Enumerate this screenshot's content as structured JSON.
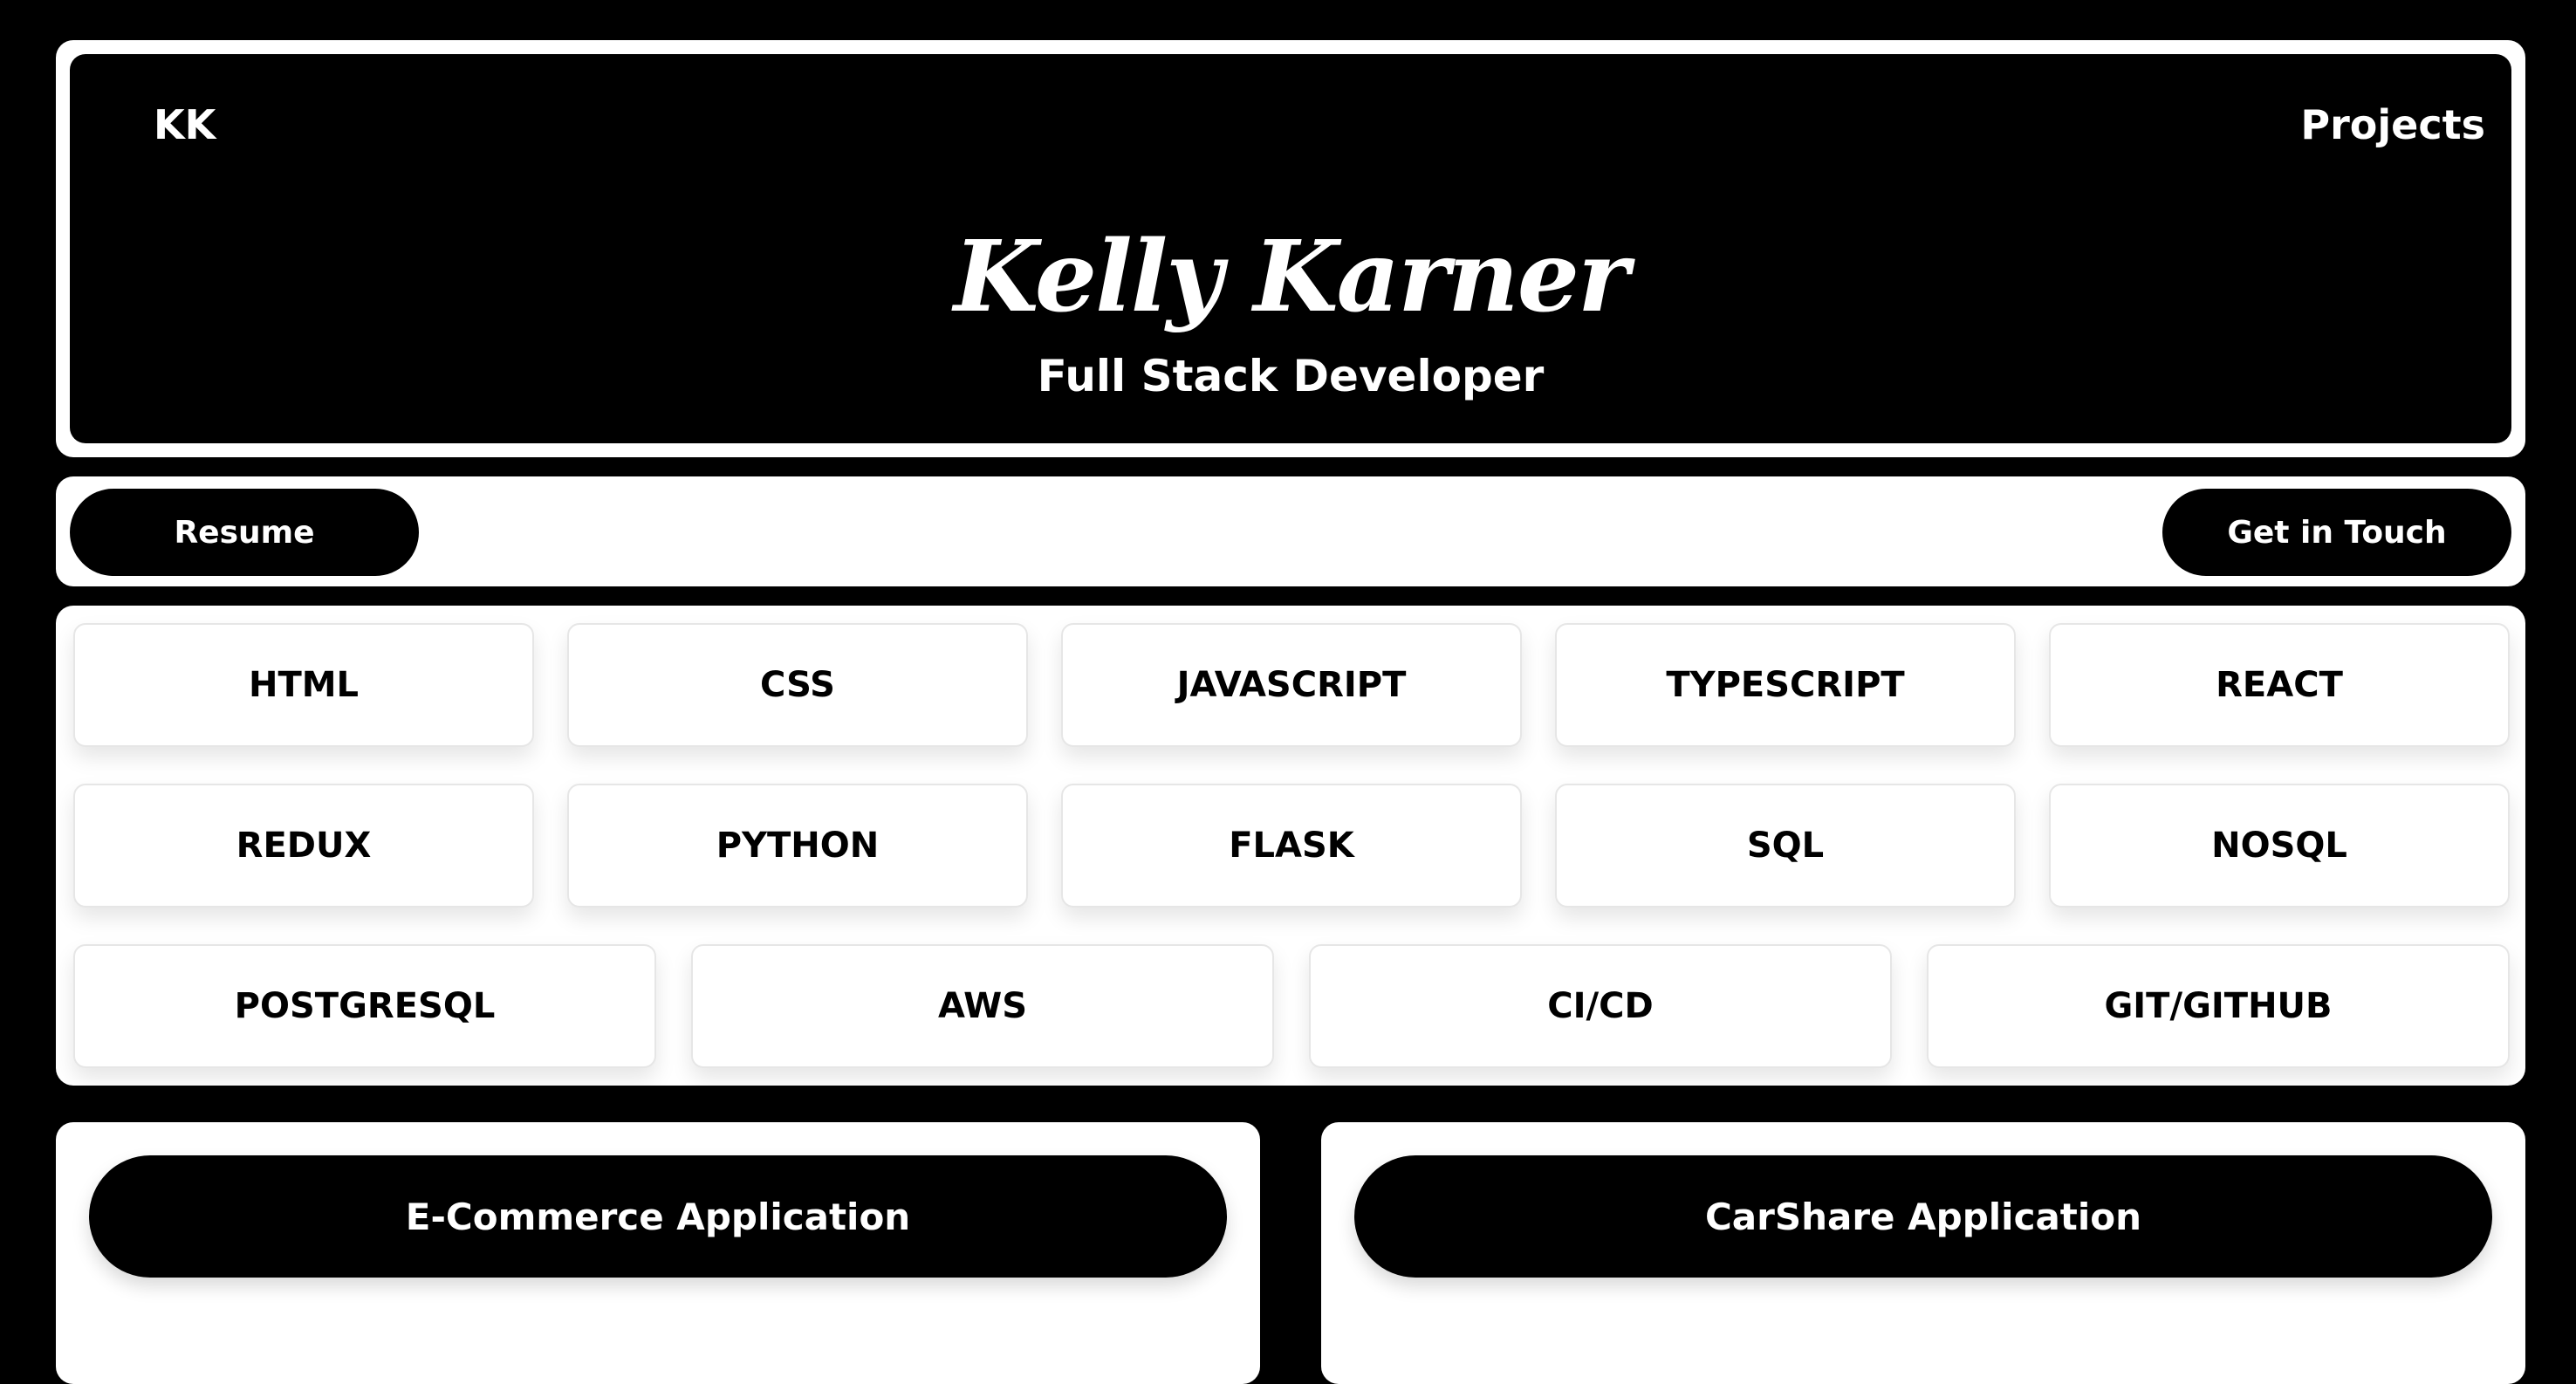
{
  "nav": {
    "logo": "KK",
    "projects": "Projects"
  },
  "hero": {
    "name": "Kelly Karner",
    "subtitle": "Full Stack Developer"
  },
  "actions": {
    "resume": "Resume",
    "contact": "Get in Touch"
  },
  "skills": {
    "row1": [
      "HTML",
      "CSS",
      "JAVASCRIPT",
      "TYPESCRIPT",
      "REACT"
    ],
    "row2": [
      "REDUX",
      "PYTHON",
      "FLASK",
      "SQL",
      "NOSQL"
    ],
    "row3": [
      "POSTGRESQL",
      "AWS",
      "CI/CD",
      "GIT/GITHUB"
    ]
  },
  "projects": [
    {
      "title": "E-Commerce Application"
    },
    {
      "title": "CarShare Application"
    }
  ]
}
